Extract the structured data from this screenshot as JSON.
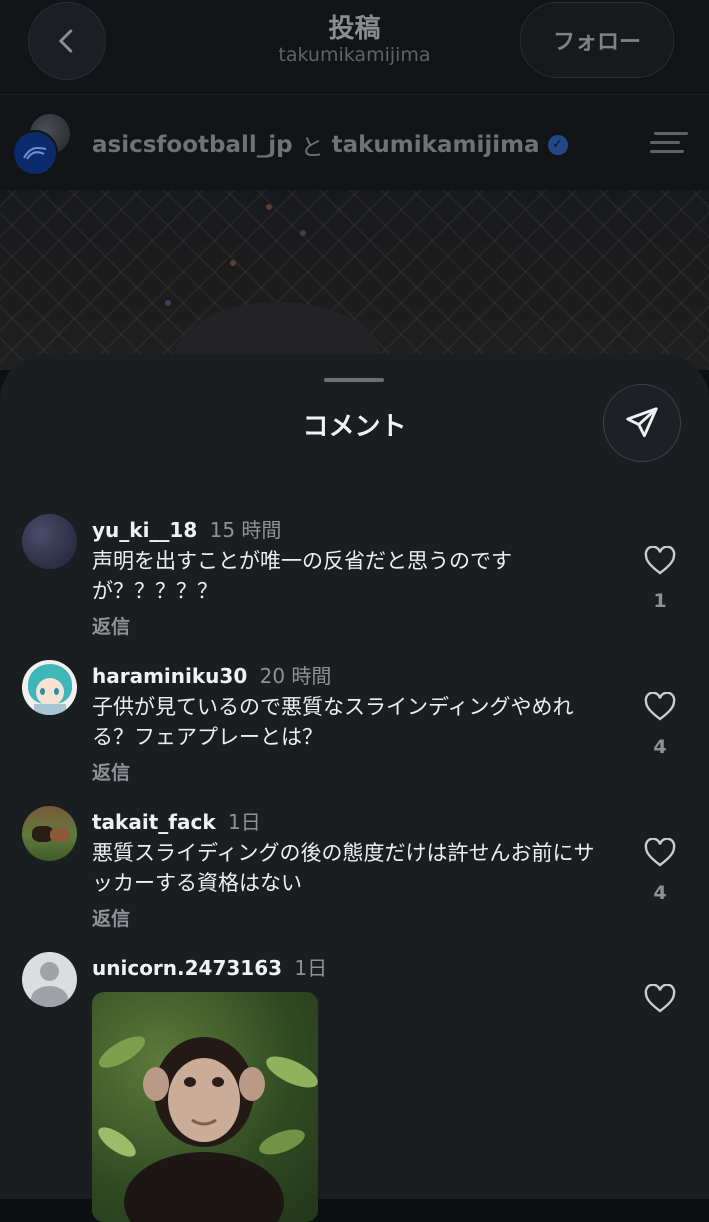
{
  "header": {
    "title": "投稿",
    "subtitle": "takumikamijima",
    "follow_label": "フォロー",
    "faded_text": "..."
  },
  "collab": {
    "user1": "asicsfootball_jp",
    "and": "と",
    "user2": "takumikamijima"
  },
  "sheet": {
    "title": "コメント"
  },
  "comments": [
    {
      "username": "yu_ki__18",
      "time": "15 時間",
      "text": "声明を出すことが唯一の反省だと思うのですが？？？？？",
      "reply_label": "返信",
      "likes": "1"
    },
    {
      "username": "haraminiku30",
      "time": "20 時間",
      "text": "子供が見ているので悪質なスラインディングやめれる？フェアプレーとは？",
      "reply_label": "返信",
      "likes": "4"
    },
    {
      "username": "takait_fack",
      "time": "1日",
      "text": "悪質スライディングの後の態度だけは許せんお前にサッカーする資格はない",
      "reply_label": "返信",
      "likes": "4"
    },
    {
      "username": "unicorn.2473163",
      "time": "1日"
    }
  ],
  "colors": {
    "sheet_bg": "#1b1e21",
    "verified": "#2f6bd6",
    "muted_text": "#8e9196"
  }
}
